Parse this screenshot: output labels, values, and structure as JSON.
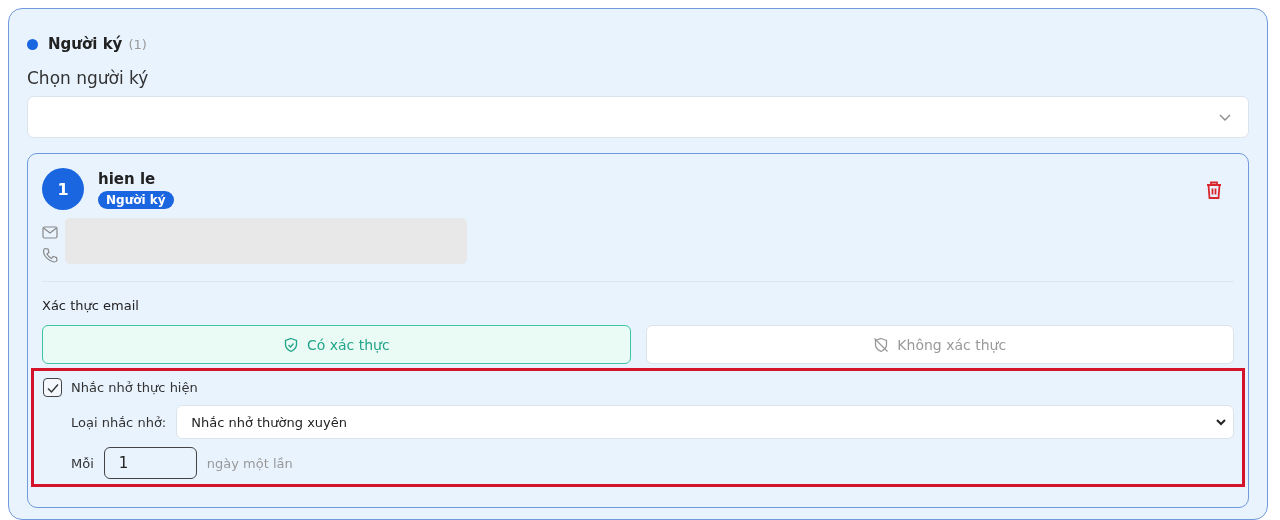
{
  "section": {
    "title": "Người ký",
    "count": "(1)",
    "color": "#1a66e0"
  },
  "signer_select": {
    "label": "Chọn người ký"
  },
  "signers": [
    {
      "number": "1",
      "name": "hien le",
      "role": "Người ký",
      "contact_redacted": true,
      "verification": {
        "label": "Xác thực email",
        "options": [
          {
            "label": "Có xác thực",
            "kind": "verified",
            "selected": true
          },
          {
            "label": "Không xác thực",
            "kind": "unverified",
            "selected": false
          }
        ]
      },
      "reminder": {
        "label": "Nhắc nhở thực hiện",
        "checked": true,
        "type_label": "Loại nhắc nhở:",
        "type_value": "Nhắc nhở thường xuyên",
        "every_label": "Mỗi",
        "every_value": "1",
        "every_unit": "ngày một lần"
      }
    }
  ]
}
